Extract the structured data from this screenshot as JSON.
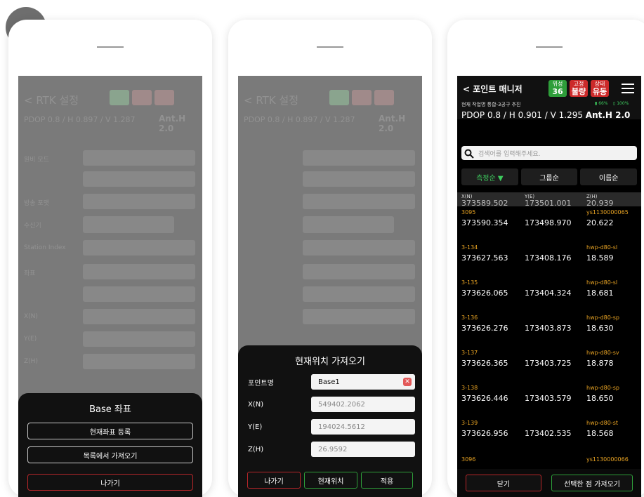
{
  "step_number": "7",
  "panel1": {
    "background": {
      "header_title": "< RTK 설정",
      "pdop": "PDOP 0.8 / H 0.897 / V 1.287",
      "ant": "Ant.H 2.0",
      "labels": [
        "원비 모드",
        "방송 포맷",
        "수신기",
        "Station Index",
        "좌표",
        "X(N)",
        "Y(E)",
        "Z(H)"
      ]
    },
    "sheet": {
      "title": "Base 좌표",
      "btn_register": "현재좌표 등록",
      "btn_from_list": "목록에서 가져오기",
      "btn_exit": "나가기"
    }
  },
  "panel2": {
    "background": {
      "header_title": "< RTK 설정",
      "pdop": "PDOP 0.8 / H 0.897 / V 1.287",
      "ant": "Ant.H 2.0"
    },
    "sheet": {
      "title": "현재위치 가져오기",
      "fields": [
        {
          "label": "포인트명",
          "value": "Base1"
        },
        {
          "label": "X(N)",
          "value": "549402.2062"
        },
        {
          "label": "Y(E)",
          "value": "194024.5612"
        },
        {
          "label": "Z(H)",
          "value": "26.9592"
        }
      ],
      "btn_exit": "나가기",
      "btn_current": "현재위치",
      "btn_apply": "적용"
    }
  },
  "panel3": {
    "header": {
      "title": "< 포인트 매니저",
      "badges": [
        {
          "top": "위성",
          "main": "36",
          "color": "#2e9e3a"
        },
        {
          "top": "고정",
          "main": "불량",
          "color": "#cc2a2a"
        },
        {
          "top": "상태",
          "main": "유동",
          "color": "#cc2a2a"
        }
      ],
      "subtitle": "현재 작업명 통합-3공구 추진",
      "status_battery": "66%",
      "status_storage": "100%",
      "pdop": "PDOP 0.8 / H 0.901 / V 1.295",
      "ant": "Ant.H 2.0"
    },
    "search_placeholder": "검색어를 입력해주세요.",
    "tabs": [
      "측정순 ▼",
      "그룹순",
      "이름순"
    ],
    "columns": [
      "X(N)",
      "Y(E)",
      "Z(H)"
    ],
    "partial_row": {
      "x": "373589.502",
      "y": "173501.001",
      "z": "20.939"
    },
    "rows": [
      {
        "name": "3095",
        "code": "ys1130000065",
        "x": "373590.354",
        "y": "173498.970",
        "z": "20.622"
      },
      {
        "name": "3-134",
        "code": "hwp-d80-sl",
        "x": "373627.563",
        "y": "173408.176",
        "z": "18.589"
      },
      {
        "name": "3-135",
        "code": "hwp-d80-sl",
        "x": "373626.065",
        "y": "173404.324",
        "z": "18.681"
      },
      {
        "name": "3-136",
        "code": "hwp-d80-sp",
        "x": "373626.276",
        "y": "173403.873",
        "z": "18.630"
      },
      {
        "name": "3-137",
        "code": "hwp-d80-sv",
        "x": "373626.365",
        "y": "173403.725",
        "z": "18.878"
      },
      {
        "name": "3-138",
        "code": "hwp-d80-sp",
        "x": "373626.446",
        "y": "173403.579",
        "z": "18.650"
      },
      {
        "name": "3-139",
        "code": "hwp-d80-st",
        "x": "373626.956",
        "y": "173402.535",
        "z": "18.568"
      }
    ],
    "last_row": {
      "name": "3096",
      "code": "ys1130000066"
    },
    "btn_close": "닫기",
    "btn_import": "선택한 점 가져오기"
  }
}
